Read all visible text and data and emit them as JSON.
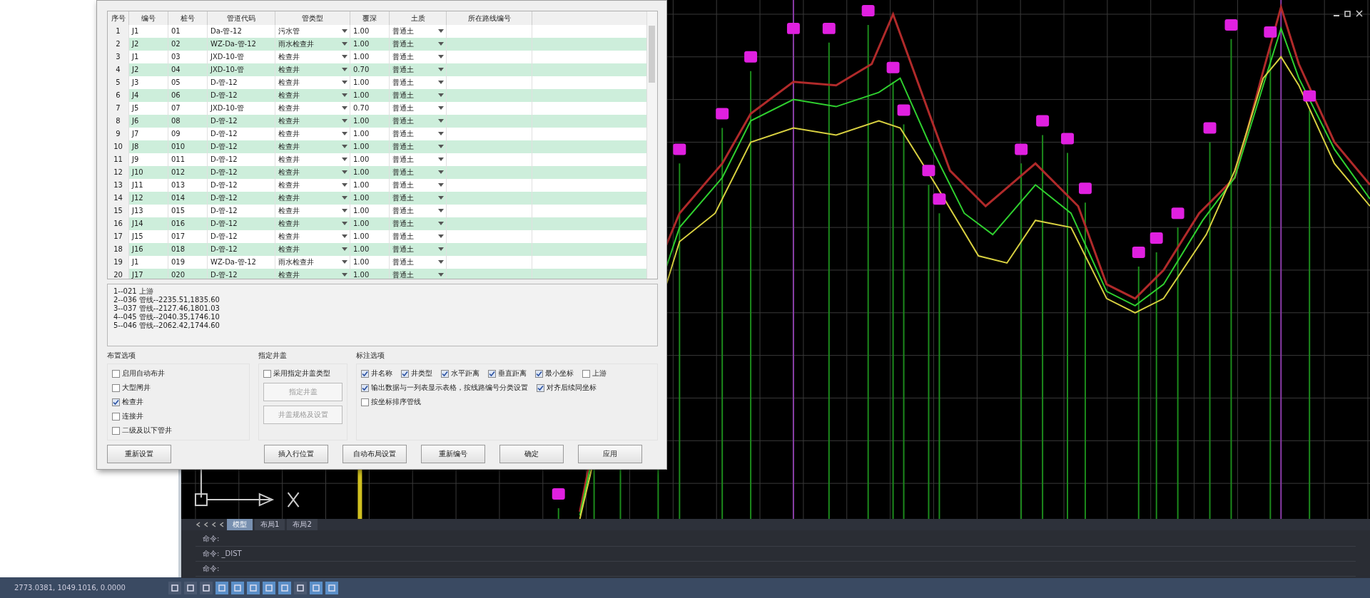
{
  "dialog": {
    "table": {
      "columns": [
        "序号",
        "编号",
        "桩号",
        "管道代码",
        "管类型",
        "覆深",
        "土质",
        "所在路线编号"
      ],
      "rows": [
        {
          "cells": [
            "1",
            "J1",
            "01",
            "Da-管-12",
            "污水管",
            "1.00",
            "普通土"
          ]
        },
        {
          "cells": [
            "2",
            "J2",
            "02",
            "WZ-Da-管-12",
            "雨水检查井",
            "1.00",
            "普通土"
          ]
        },
        {
          "cells": [
            "3",
            "J1",
            "03",
            "JXD-10-管",
            "检查井",
            "1.00",
            "普通土"
          ]
        },
        {
          "cells": [
            "4",
            "J2",
            "04",
            "JXD-10-管",
            "检查井",
            "0.70",
            "普通土"
          ]
        },
        {
          "cells": [
            "5",
            "J3",
            "05",
            "D-管-12",
            "检查井",
            "1.00",
            "普通土"
          ]
        },
        {
          "cells": [
            "6",
            "J4",
            "06",
            "D-管-12",
            "检查井",
            "1.00",
            "普通土"
          ]
        },
        {
          "cells": [
            "7",
            "J5",
            "07",
            "JXD-10-管",
            "检查井",
            "0.70",
            "普通土"
          ]
        },
        {
          "cells": [
            "8",
            "J6",
            "08",
            "D-管-12",
            "检查井",
            "1.00",
            "普通土"
          ]
        },
        {
          "cells": [
            "9",
            "J7",
            "09",
            "D-管-12",
            "检查井",
            "1.00",
            "普通土"
          ]
        },
        {
          "cells": [
            "10",
            "J8",
            "010",
            "D-管-12",
            "检查井",
            "1.00",
            "普通土"
          ]
        },
        {
          "cells": [
            "11",
            "J9",
            "011",
            "D-管-12",
            "检查井",
            "1.00",
            "普通土"
          ]
        },
        {
          "cells": [
            "12",
            "J10",
            "012",
            "D-管-12",
            "检查井",
            "1.00",
            "普通土"
          ]
        },
        {
          "cells": [
            "13",
            "J11",
            "013",
            "D-管-12",
            "检查井",
            "1.00",
            "普通土"
          ]
        },
        {
          "cells": [
            "14",
            "J12",
            "014",
            "D-管-12",
            "检查井",
            "1.00",
            "普通土"
          ]
        },
        {
          "cells": [
            "15",
            "J13",
            "015",
            "D-管-12",
            "检查井",
            "1.00",
            "普通土"
          ]
        },
        {
          "cells": [
            "16",
            "J14",
            "016",
            "D-管-12",
            "检查井",
            "1.00",
            "普通土"
          ]
        },
        {
          "cells": [
            "17",
            "J15",
            "017",
            "D-管-12",
            "检查井",
            "1.00",
            "普通土"
          ]
        },
        {
          "cells": [
            "18",
            "J16",
            "018",
            "D-管-12",
            "检查井",
            "1.00",
            "普通土"
          ]
        },
        {
          "cells": [
            "19",
            "J1",
            "019",
            "WZ-Da-管-12",
            "雨水检查井",
            "1.00",
            "普通土"
          ]
        },
        {
          "cells": [
            "20",
            "J17",
            "020",
            "D-管-12",
            "检查井",
            "1.00",
            "普通土"
          ]
        }
      ]
    },
    "log": [
      "1--021  上游",
      "2--036  管线--2235.51,1835.60",
      "3--037  管线--2127.46,1801.03",
      "4--045  管线--2040.35,1746.10",
      "5--046  管线--2062.42,1744.60"
    ],
    "groups": [
      {
        "title": "布置选项",
        "options": [
          {
            "label": "启用自动布井",
            "checked": false
          },
          {
            "label": "大型闸井",
            "checked": false
          },
          {
            "label": "检查井",
            "checked": true
          },
          {
            "label": "连接井",
            "checked": false
          },
          {
            "label": "二级及以下管井",
            "checked": false
          }
        ]
      },
      {
        "title": "指定井盖",
        "options": [
          {
            "label": "采用指定井盖类型",
            "checked": false
          }
        ],
        "buttons": [
          {
            "label": "指定井盖",
            "disabled": true
          },
          {
            "label": "井盖规格及设置",
            "disabled": true
          }
        ]
      },
      {
        "title": "标注选项",
        "options": [
          {
            "label": "井名称",
            "checked": true
          },
          {
            "label": "井类型",
            "checked": true
          },
          {
            "label": "水平距离",
            "checked": true
          },
          {
            "label": "垂直距离",
            "checked": true
          },
          {
            "label": "最小坐标",
            "checked": true
          },
          {
            "label": "上游",
            "checked": false
          },
          {
            "label": "输出数据与一列表显示表格，按线路编号分类设置",
            "checked": true
          },
          {
            "label": "对齐后续同坐标",
            "checked": true
          },
          {
            "label": "按坐标排序管线",
            "checked": false
          }
        ]
      }
    ],
    "buttons": [
      "重新设置",
      "插入行位置",
      "自动布局设置",
      "重新编号",
      "确定",
      "应用"
    ]
  },
  "cad": {
    "layout_tabs": [
      {
        "label": "模型",
        "selected": true
      },
      {
        "label": "布局1",
        "selected": false
      },
      {
        "label": "布局2",
        "selected": false
      }
    ],
    "command_lines": [
      "命令:",
      "命令: _DIST",
      "命令:"
    ]
  },
  "status_bar": {
    "coordinates": "2773.0381, 1049.1016, 0.0000",
    "toggles": [
      {
        "on": false
      },
      {
        "on": false
      },
      {
        "on": false
      },
      {
        "on": true
      },
      {
        "on": true
      },
      {
        "on": true
      },
      {
        "on": true
      },
      {
        "on": true
      },
      {
        "on": false
      },
      {
        "on": true
      },
      {
        "on": true
      }
    ]
  }
}
